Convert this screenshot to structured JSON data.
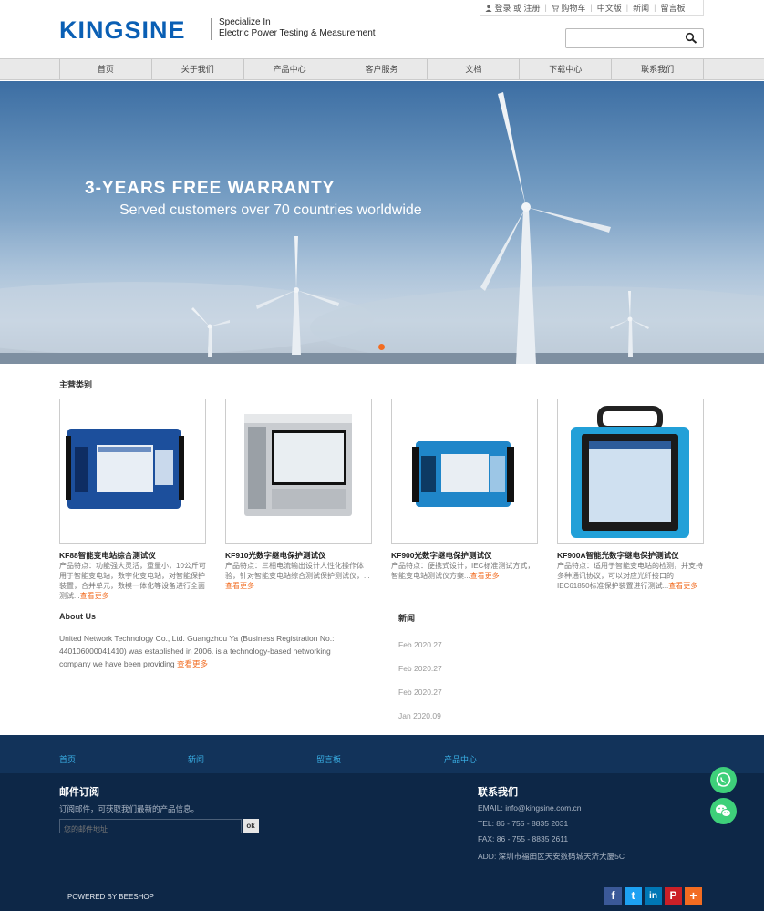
{
  "brand": {
    "logo": "KINGSINE",
    "tagline_line1": "Specialize In",
    "tagline_line2": "Electric Power Testing & Measurement",
    "accent": "#0a5fb4",
    "highlight": "#f26c21"
  },
  "topbar": {
    "login": "登录 或 注册",
    "cart": "购物车",
    "lang": "中文版",
    "news": "新闻",
    "board": "留言板"
  },
  "search": {
    "placeholder": "",
    "icon": "search-icon"
  },
  "nav": {
    "items": [
      "首页",
      "关于我们",
      "产品中心",
      "客户服务",
      "文档",
      "下载中心",
      "联系我们"
    ]
  },
  "banner": {
    "title": "3-YEARS FREE WARRANTY",
    "subtitle": "Served customers over 70 countries worldwide"
  },
  "products": {
    "section_title": "主营类别",
    "items": [
      {
        "name": "KF88智能变电站综合测试仪",
        "desc": "产品特点：功能强大灵活，重量小，10公斤可用于智能变电站，数字化变电站，对智能保护装置，合并单元，数模一体化等设备进行全面测试...",
        "more": "查看更多"
      },
      {
        "name": "KF910光数字继电保护测试仪",
        "desc": "产品特点：三相电流输出设计人性化操作体验，针对智能变电站综合测试保护测试仪，...",
        "more": "查看更多"
      },
      {
        "name": "KF900光数字继电保护测试仪",
        "desc": "产品特点：便携式设计，IEC标准测试方式，智能变电站测试仪方案...",
        "more": "查看更多"
      },
      {
        "name": "KF900A智能光数字继电保护测试仪",
        "desc": "产品特点：适用于智能变电站的检测，并支持多种通讯协议，可以对应光纤接口的IEC61850标准保护装置进行测试...",
        "more": "查看更多"
      }
    ]
  },
  "about": {
    "title": "About Us",
    "text": "United Network Technology Co., Ltd. Guangzhou Ya (Business Registration No.: 440106000041410) was established in 2006. is a technology-based networking company we have been providing",
    "more": "查看更多"
  },
  "news": {
    "title": "新闻",
    "dates": [
      "Feb 2020.27",
      "Feb 2020.27",
      "Feb 2020.27",
      "Jan 2020.09"
    ]
  },
  "footer_links": [
    "首页",
    "新闻",
    "留言板",
    "产品中心"
  ],
  "subscribe": {
    "title": "邮件订阅",
    "text": "订阅邮件，可获取我们最新的产品信息。",
    "placeholder": "您的邮件地址",
    "button": "ok"
  },
  "contact": {
    "title": "联系我们",
    "email": "EMAIL: info@kingsine.com.cn",
    "tel": "TEL: 86 - 755 - 8835 2031",
    "fax": "FAX: 86 - 755 - 8835 2611",
    "addr": "ADD: 深圳市福田区天安数码城天济大厦5C"
  },
  "powered": "POWERED BY BEESHOP",
  "social": [
    {
      "icon": "facebook-icon",
      "glyph": "f",
      "color": "#3b5998"
    },
    {
      "icon": "twitter-icon",
      "glyph": "t",
      "color": "#1da1f2"
    },
    {
      "icon": "linkedin-icon",
      "glyph": "in",
      "color": "#0077b5"
    },
    {
      "icon": "pinterest-icon",
      "glyph": "P",
      "color": "#cb2027"
    },
    {
      "icon": "share-plus-icon",
      "glyph": "+",
      "color": "#f26c21"
    }
  ],
  "floating": [
    {
      "icon": "whatsapp-icon"
    },
    {
      "icon": "wechat-icon"
    }
  ]
}
